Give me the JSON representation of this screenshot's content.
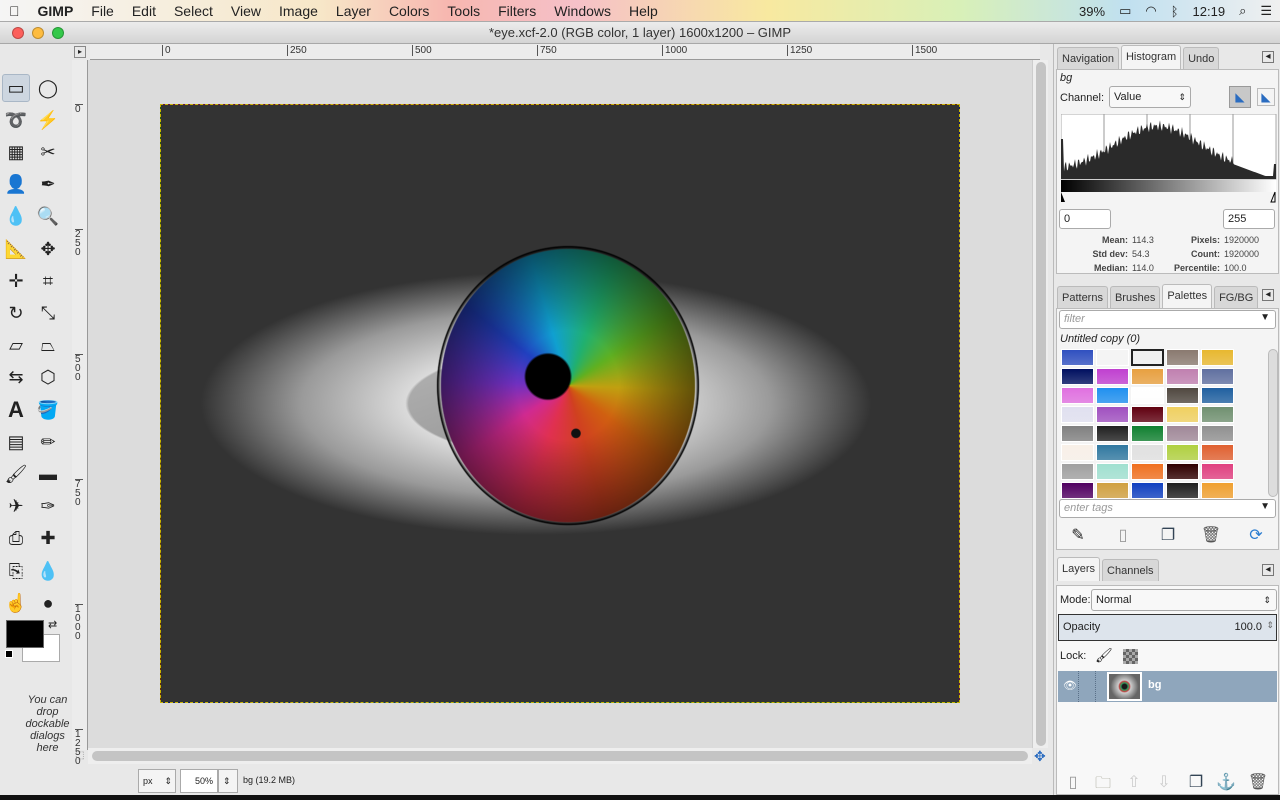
{
  "menubar": {
    "apple": "",
    "app": "GIMP",
    "items": [
      "File",
      "Edit",
      "Select",
      "View",
      "Image",
      "Layer",
      "Colors",
      "Tools",
      "Filters",
      "Windows",
      "Help"
    ],
    "battery": "39%",
    "clock": "12:19",
    "icons": [
      "battery-icon",
      "wifi-icon",
      "bluetooth-icon",
      "spotlight-icon",
      "notification-list-icon"
    ]
  },
  "window": {
    "title": "*eye.xcf-2.0 (RGB color, 1 layer) 1600x1200 – GIMP"
  },
  "toolbox": {
    "tools": [
      "rect-select",
      "ellipse-select",
      "free-select",
      "fuzzy-select",
      "select-by-color",
      "scissors",
      "foreground-select",
      "paths",
      "color-picker",
      "zoom",
      "measure",
      "move",
      "align",
      "crop",
      "rotate",
      "scale",
      "shear",
      "perspective",
      "flip",
      "cage",
      "text",
      "bucket-fill",
      "blend",
      "pencil",
      "paintbrush",
      "eraser",
      "airbrush",
      "ink",
      "clone",
      "heal",
      "perspective-clone",
      "blur",
      "smudge",
      "dodge-burn"
    ],
    "fg_color": "#000000",
    "bg_color": "#ffffff",
    "drop_hint": "You can drop dockable dialogs here"
  },
  "rulers": {
    "top": [
      "0",
      "250",
      "500",
      "750",
      "1000",
      "1250",
      "1500"
    ],
    "left": [
      "0",
      "250",
      "500",
      "750",
      "1000",
      "1250"
    ]
  },
  "status": {
    "unit": "px",
    "zoom": "50%",
    "info": "bg (19.2 MB)"
  },
  "histogram_dock": {
    "tabs": [
      "Navigation",
      "Histogram",
      "Undo"
    ],
    "active_tab": "Histogram",
    "layer": "bg",
    "channel_label": "Channel:",
    "channel": "Value",
    "range_min": "0",
    "range_max": "255",
    "stats": {
      "mean_label": "Mean:",
      "mean": "114.3",
      "std_label": "Std dev:",
      "std": "54.3",
      "median_label": "Median:",
      "median": "114.0",
      "pixels_label": "Pixels:",
      "pixels": "1920000",
      "count_label": "Count:",
      "count": "1920000",
      "percentile_label": "Percentile:",
      "percentile": "100.0"
    }
  },
  "palettes_dock": {
    "tabs": [
      "Patterns",
      "Brushes",
      "Palettes",
      "FG/BG"
    ],
    "active_tab": "Palettes",
    "filter_placeholder": "filter",
    "selected": "Untitled copy (0)",
    "tags_placeholder": "enter tags",
    "swatches": [
      "#3050c0",
      "#f4f4f4",
      "#f0f0f0",
      "#8a7a70",
      "#e8b830",
      "#001060",
      "#c040d0",
      "#e8a040",
      "#c080b0",
      "#6070a0",
      "#e070e0",
      "#2090f0",
      "#ffffff",
      "#504840",
      "#2060a0",
      "#e0e0f0",
      "#a050c0",
      "#600010",
      "#f0d060",
      "#709070",
      "#808080",
      "#202020",
      "#108030",
      "#a08898",
      "#909090",
      "#f8f0e8",
      "#3078a0",
      "#e0e0e0",
      "#b0d040",
      "#e06030",
      "#a0a0a0",
      "#a0e0d0",
      "#f07020",
      "#300000",
      "#e04080",
      "#500060",
      "#d0a040",
      "#1040c0",
      "#202020",
      "#f0a030",
      "#000830",
      "#ffffff",
      "#f8a0d0"
    ],
    "buttons": [
      "edit-palette",
      "new-palette",
      "duplicate-palette",
      "delete-palette",
      "refresh-palettes"
    ]
  },
  "layers_dock": {
    "tabs": [
      "Layers",
      "Channels"
    ],
    "active_tab": "Layers",
    "mode_label": "Mode:",
    "mode": "Normal",
    "opacity_label": "Opacity",
    "opacity": "100.0",
    "lock_label": "Lock:",
    "layers": [
      {
        "name": "bg",
        "visible": true
      }
    ],
    "buttons": [
      "new-layer",
      "new-layer-group",
      "raise-layer",
      "lower-layer",
      "duplicate-layer",
      "anchor-layer",
      "delete-layer"
    ]
  }
}
